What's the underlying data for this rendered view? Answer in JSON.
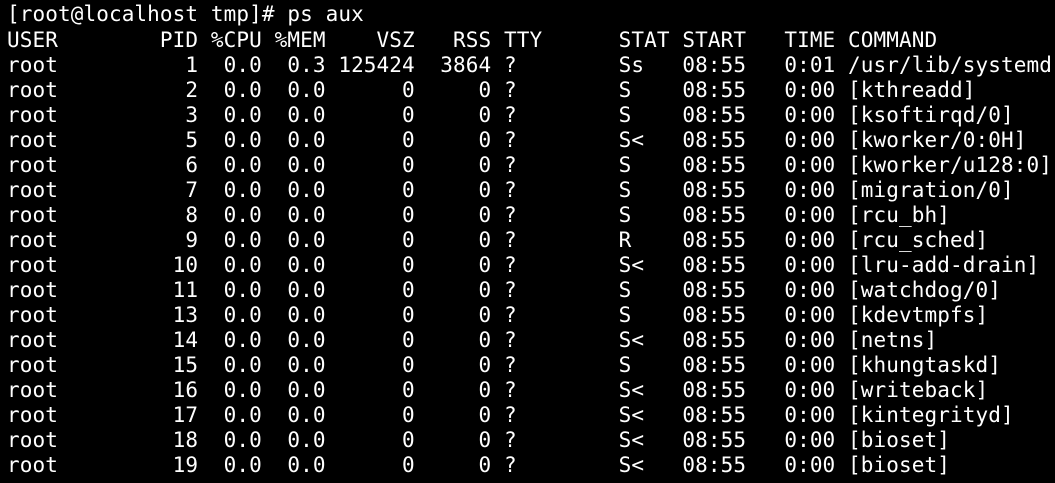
{
  "terminal": {
    "background": "#000000",
    "foreground": "#ffffff",
    "prompt_line": "[root@localhost tmp]# ps aux",
    "header_line": "USER        PID %CPU %MEM    VSZ   RSS TTY      STAT START   TIME COMMAND",
    "process_lines": [
      "root          1  0.0  0.3 125424  3864 ?        Ss   08:55   0:01 /usr/lib/systemd",
      "root          2  0.0  0.0      0     0 ?        S    08:55   0:00 [kthreadd]",
      "root          3  0.0  0.0      0     0 ?        S    08:55   0:00 [ksoftirqd/0]",
      "root          5  0.0  0.0      0     0 ?        S<   08:55   0:00 [kworker/0:0H]",
      "root          6  0.0  0.0      0     0 ?        S    08:55   0:00 [kworker/u128:0]",
      "root          7  0.0  0.0      0     0 ?        S    08:55   0:00 [migration/0]",
      "root          8  0.0  0.0      0     0 ?        S    08:55   0:00 [rcu_bh]",
      "root          9  0.0  0.0      0     0 ?        R    08:55   0:00 [rcu_sched]",
      "root         10  0.0  0.0      0     0 ?        S<   08:55   0:00 [lru-add-drain]",
      "root         11  0.0  0.0      0     0 ?        S    08:55   0:00 [watchdog/0]",
      "root         13  0.0  0.0      0     0 ?        S    08:55   0:00 [kdevtmpfs]",
      "root         14  0.0  0.0      0     0 ?        S<   08:55   0:00 [netns]",
      "root         15  0.0  0.0      0     0 ?        S    08:55   0:00 [khungtaskd]",
      "root         16  0.0  0.0      0     0 ?        S<   08:55   0:00 [writeback]",
      "root         17  0.0  0.0      0     0 ?        S<   08:55   0:00 [kintegrityd]",
      "root         18  0.0  0.0      0     0 ?        S<   08:55   0:00 [bioset]",
      "root         19  0.0  0.0      0     0 ?        S<   08:55   0:00 [bioset]"
    ]
  }
}
